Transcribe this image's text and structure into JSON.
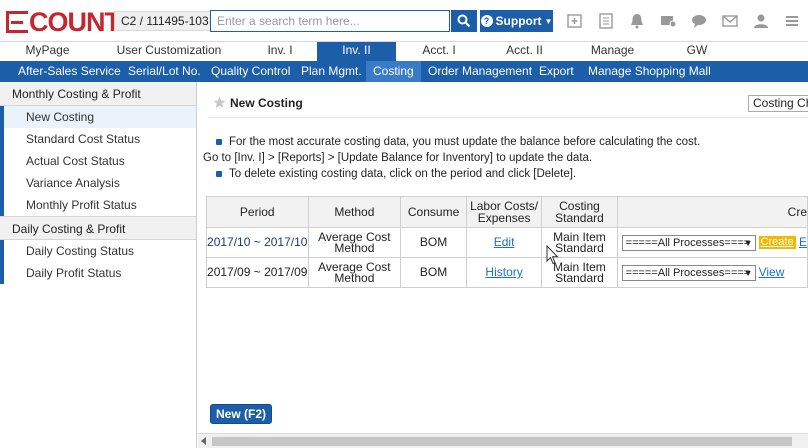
{
  "header": {
    "logo": "ECOUNT",
    "company_code": "C2 / ",
    "company_id": "111495-103",
    "search_placeholder": "Enter a search term here...",
    "support_label": "Support"
  },
  "main_tabs": [
    {
      "label": "MyPage",
      "active": false
    },
    {
      "label": "User Customization",
      "active": false
    },
    {
      "label": "Inv. I",
      "active": false
    },
    {
      "label": "Inv. II",
      "active": true
    },
    {
      "label": "Acct. I",
      "active": false
    },
    {
      "label": "Acct. II",
      "active": false
    },
    {
      "label": "Manage",
      "active": false
    },
    {
      "label": "GW",
      "active": false
    }
  ],
  "sub_menu": [
    {
      "label": "After-Sales Service"
    },
    {
      "label": "Serial/Lot No."
    },
    {
      "label": "Quality Control"
    },
    {
      "label": "Plan Mgmt."
    },
    {
      "label": "Costing"
    },
    {
      "label": "Order Management"
    },
    {
      "label": "Export"
    },
    {
      "label": "Manage Shopping Mall"
    }
  ],
  "sidebar": {
    "group1": "Monthly Costing & Profit",
    "group1_items": [
      {
        "label": "New Costing"
      },
      {
        "label": "Standard Cost Status"
      },
      {
        "label": "Actual Cost Status"
      },
      {
        "label": "Variance Analysis"
      },
      {
        "label": "Monthly Profit Status"
      }
    ],
    "group2": "Daily Costing & Profit",
    "group2_items": [
      {
        "label": "Daily Costing Status"
      },
      {
        "label": "Daily Profit Status"
      }
    ]
  },
  "page": {
    "title": "New Costing",
    "costing_select": "Costing Ch",
    "info_line1": "For the most accurate costing data, you must update the balance before calculating the cost.",
    "info_line2": "Go to [Inv. I] > [Reports] > [Update Balance for Inventory] to update the data.",
    "info_line3": "To delete existing costing data, click on the period and click [Delete].",
    "new_button": "New (F2)"
  },
  "table": {
    "headers": [
      "Period",
      "Method",
      "Consume",
      "Labor Costs/ Expenses",
      "Costing Standard",
      "Cre"
    ],
    "rows": [
      {
        "period": "2017/10 ~ 2017/10",
        "method": "Average Cost Method",
        "consume": "BOM",
        "labor_link": "Edit",
        "standard": "Main Item Standard",
        "process": "=====All Processes====",
        "create": "Create",
        "extra": "E"
      },
      {
        "period": "2017/09 ~ 2017/09",
        "method": "Average Cost Method",
        "consume": "BOM",
        "labor_link": "History",
        "standard": "Main Item Standard",
        "process": "=====All Processes====",
        "create": "",
        "extra": "View"
      }
    ]
  },
  "colors": {
    "brand_red": "#c4272f",
    "accent_blue": "#1c5ea8",
    "create_yellow": "#f5b800",
    "link_blue": "#1a73c9"
  }
}
